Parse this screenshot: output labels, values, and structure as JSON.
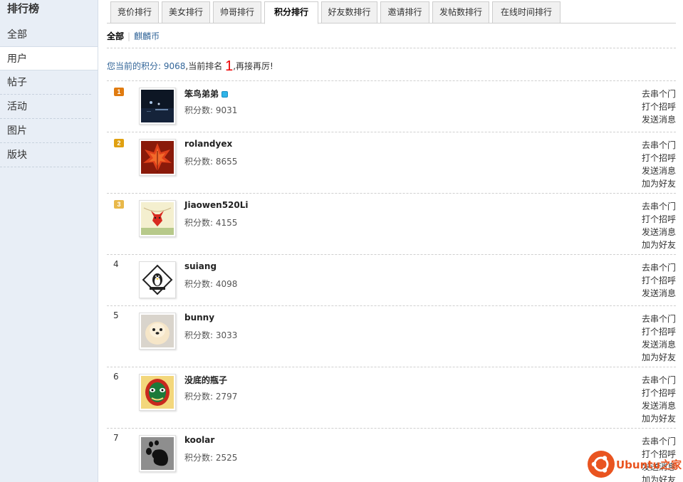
{
  "sidebar": {
    "title": "排行榜",
    "items": [
      {
        "label": "全部"
      },
      {
        "label": "用户"
      },
      {
        "label": "帖子"
      },
      {
        "label": "活动"
      },
      {
        "label": "图片"
      },
      {
        "label": "版块"
      }
    ]
  },
  "tabs": [
    {
      "label": "竞价排行"
    },
    {
      "label": "美女排行"
    },
    {
      "label": "帅哥排行"
    },
    {
      "label": "积分排行"
    },
    {
      "label": "好友数排行"
    },
    {
      "label": "邀请排行"
    },
    {
      "label": "发帖数排行"
    },
    {
      "label": "在线时间排行"
    }
  ],
  "subnav": {
    "all": "全部",
    "coin": "麒麟币"
  },
  "summary": {
    "prefix": "您当前的积分: 9068",
    "middle": ",当前排名",
    "rank": "1",
    "suffix": ",再接再厉!"
  },
  "colors": {
    "gold": "#e07b10",
    "silver": "#e0a010",
    "bronze": "#e8b84a",
    "link": "#336699"
  },
  "users": [
    {
      "rank": "1",
      "name": "笨鸟弟弟",
      "score": "积分数: 9031",
      "actions": [
        "去串个门",
        "打个招呼",
        "发送消息"
      ],
      "avatar": "night-city-icon"
    },
    {
      "rank": "2",
      "name": "rolandyex",
      "score": "积分数: 8655",
      "actions": [
        "去串个门",
        "打个招呼",
        "发送消息",
        "加为好友"
      ],
      "avatar": "red-leaf-icon"
    },
    {
      "rank": "3",
      "name": "Jiaowen520Li",
      "score": "积分数: 4155",
      "actions": [
        "去串个门",
        "打个招呼",
        "发送消息",
        "加为好友"
      ],
      "avatar": "red-fox-icon"
    },
    {
      "rank": "4",
      "name": "suiang",
      "score": "积分数: 4098",
      "actions": [
        "去串个门",
        "打个招呼",
        "发送消息"
      ],
      "avatar": "linux-penguin-icon"
    },
    {
      "rank": "5",
      "name": "bunny",
      "score": "积分数: 3033",
      "actions": [
        "去串个门",
        "打个招呼",
        "发送消息",
        "加为好友"
      ],
      "avatar": "pomeranian-dog-icon"
    },
    {
      "rank": "6",
      "name": "没底的瓶子",
      "score": "积分数: 2797",
      "actions": [
        "去串个门",
        "打个招呼",
        "发送消息",
        "加为好友"
      ],
      "avatar": "opera-mask-icon"
    },
    {
      "rank": "7",
      "name": "koolar",
      "score": "积分数: 2525",
      "actions": [
        "去串个门",
        "打个招呼",
        "发送消息",
        "加为好友"
      ],
      "avatar": "gnome-foot-icon"
    }
  ],
  "watermark": {
    "text": "Ubuntu之家"
  }
}
